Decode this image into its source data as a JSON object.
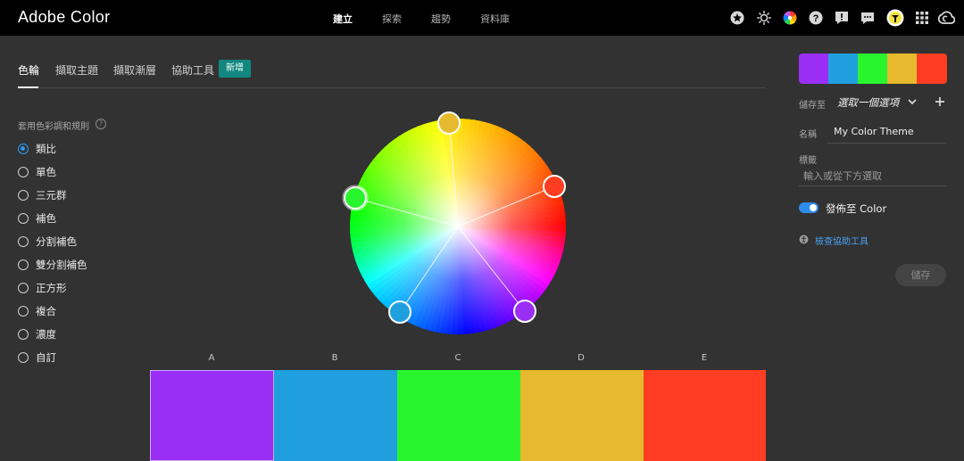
{
  "app": {
    "title": "Adobe Color"
  },
  "topnav": [
    {
      "label": "建立",
      "active": true
    },
    {
      "label": "探索",
      "active": false
    },
    {
      "label": "趨勢",
      "active": false
    },
    {
      "label": "資料庫",
      "active": false
    }
  ],
  "top_icons": [
    "star-icon",
    "brightness-icon",
    "color-wheel-icon",
    "help-icon",
    "notification-icon",
    "chat-icon",
    "avatar",
    "apps-grid-icon",
    "creative-cloud-icon"
  ],
  "tabs": [
    {
      "label": "色輪",
      "active": true
    },
    {
      "label": "擷取主題",
      "active": false
    },
    {
      "label": "擷取漸層",
      "active": false
    },
    {
      "label": "協助工具",
      "active": false
    }
  ],
  "new_badge": "新增",
  "rules": {
    "heading": "套用色彩調和規則",
    "help": "?",
    "options": [
      "類比",
      "單色",
      "三元群",
      "補色",
      "分割補色",
      "雙分割補色",
      "正方形",
      "複合",
      "濃度",
      "自訂"
    ],
    "selected": 0
  },
  "swatches": [
    {
      "letter": "A",
      "color": "#9b2ef5"
    },
    {
      "letter": "B",
      "color": "#209fdf"
    },
    {
      "letter": "C",
      "color": "#29f52f"
    },
    {
      "letter": "D",
      "color": "#e6b92e"
    },
    {
      "letter": "E",
      "color": "#ff3d22"
    }
  ],
  "wheel_handles": [
    {
      "name": "handle-a",
      "color": "#9b2ef5"
    },
    {
      "name": "handle-b",
      "color": "#209fdf"
    },
    {
      "name": "handle-c",
      "color": "#29f52f"
    },
    {
      "name": "handle-d",
      "color": "#e6b92e"
    },
    {
      "name": "handle-e",
      "color": "#ff3d22"
    }
  ],
  "panel": {
    "save_to_label": "儲存至",
    "save_to_value": "選取一個選項",
    "name_label": "名稱",
    "name_value": "My Color Theme",
    "tags_label": "標籤",
    "tags_placeholder": "輸入或從下方選取",
    "publish_label": "發佈至 Color",
    "publish_on": true,
    "accessibility_link": "檢查協助工具",
    "save_button": "儲存"
  }
}
